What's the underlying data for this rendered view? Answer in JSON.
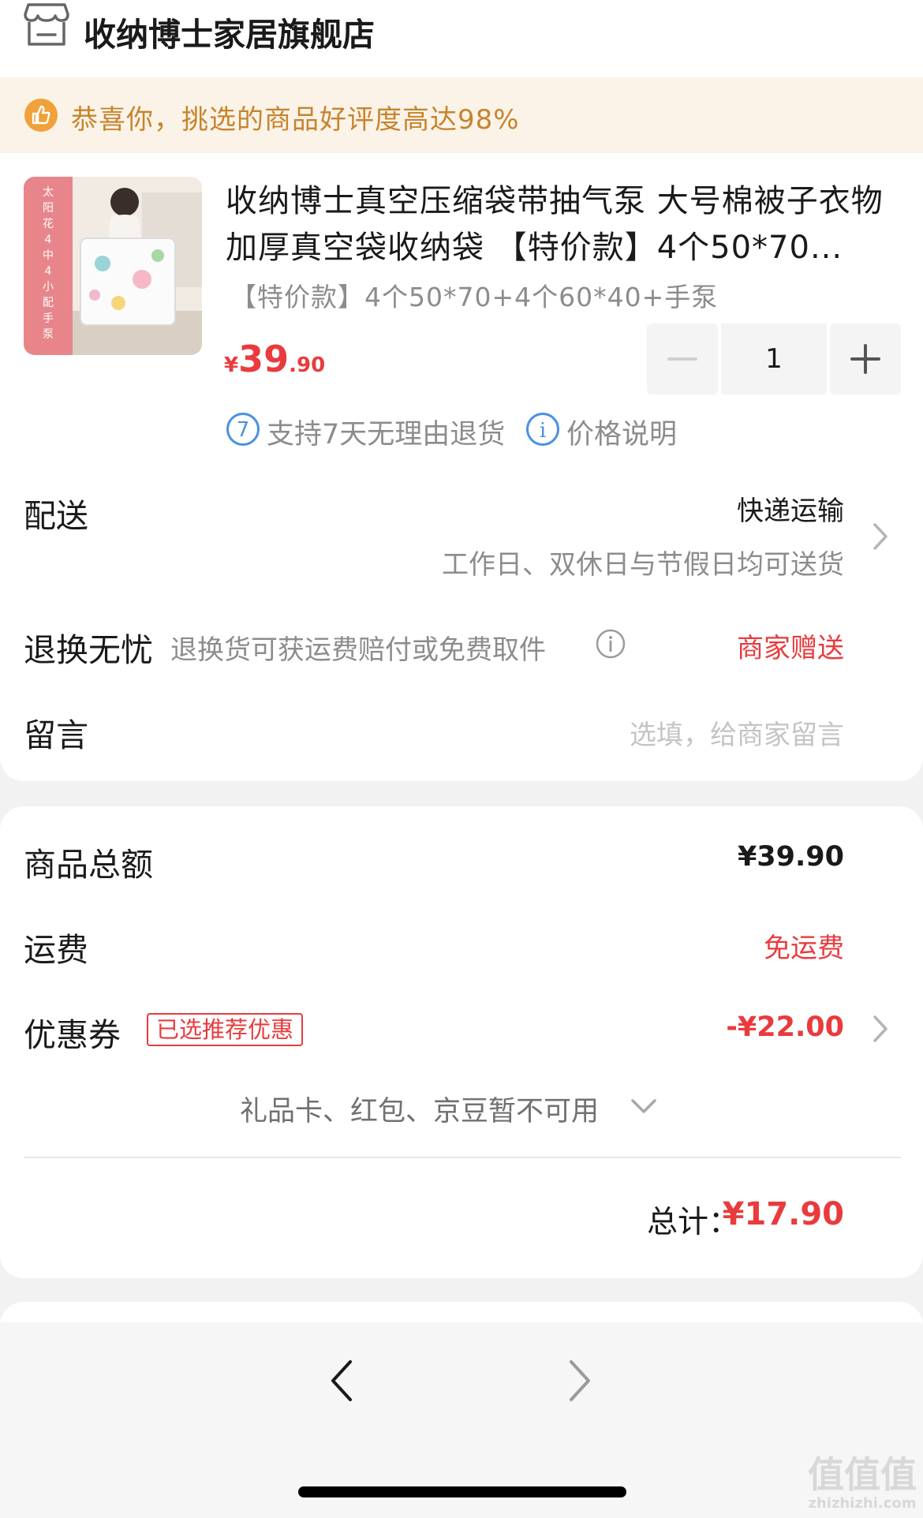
{
  "store": {
    "name": "收纳博士家居旗舰店",
    "icon": "store-icon"
  },
  "notice": {
    "icon": "thumbs-up-icon",
    "text": "恭喜你，挑选的商品好评度高达98%"
  },
  "product": {
    "thumb_badge": "太阳花4中4小配手泵",
    "title": "收纳博士真空压缩袋带抽气泵 大号棉被子衣物加厚真空袋收纳袋 【特价款】4个50*70...",
    "spec": "【特价款】4个50*70+4个60*40+手泵",
    "price_symbol": "¥",
    "price_int": "39",
    "price_dec": ".90",
    "quantity": "1",
    "badges": [
      {
        "icon": "seven-day-return-icon",
        "glyph": "7",
        "text": "支持7天无理由退货"
      },
      {
        "icon": "info-icon",
        "glyph": "i",
        "text": "价格说明"
      }
    ]
  },
  "delivery": {
    "label": "配送",
    "method": "快递运输",
    "note": "工作日、双休日与节假日均可送货"
  },
  "returns": {
    "label": "退换无忧",
    "desc": "退换货可获运费赔付或免费取件",
    "value": "商家赠送"
  },
  "message": {
    "label": "留言",
    "placeholder": "选填，给商家留言"
  },
  "summary": {
    "goods_label": "商品总额",
    "goods_value": "¥39.90",
    "shipping_label": "运费",
    "shipping_value": "免运费",
    "coupon_label": "优惠券",
    "coupon_tag": "已选推荐优惠",
    "coupon_value": "-¥22.00",
    "extras": "礼品卡、红包、京豆暂不可用",
    "total_label": "总计：",
    "total_value": "¥17.90"
  },
  "watermark": {
    "top": "值值值",
    "bottom": "zhizhizhi.com"
  },
  "colors": {
    "accent": "#e93b3d",
    "notice_bg": "#fbf3e8",
    "notice_text": "#c7842d",
    "badge_blue": "#4a90e2"
  }
}
